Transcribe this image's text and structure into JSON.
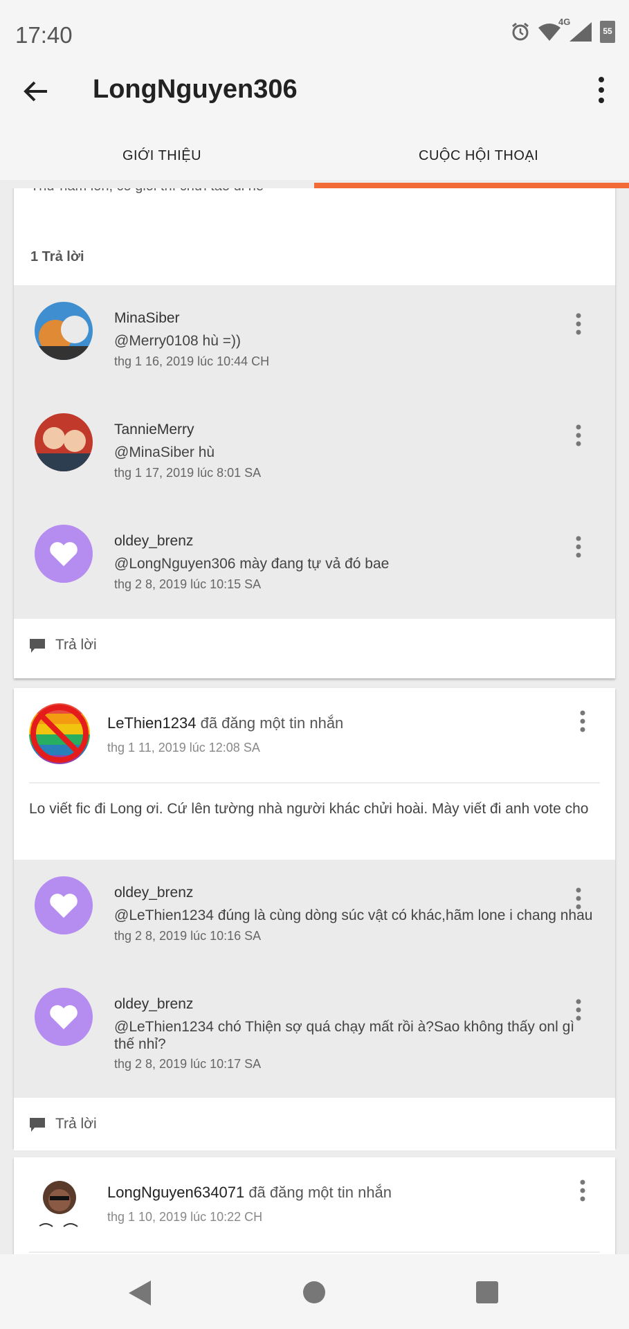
{
  "status_bar": {
    "time": "17:40",
    "network": "4G",
    "battery": "55"
  },
  "app_bar": {
    "title": "LongNguyen306",
    "back_icon": "arrow-left-icon",
    "menu_icon": "more-vert-icon",
    "tabs": [
      {
        "label": "GIỚI THIỆU",
        "selected": false
      },
      {
        "label": "CUỘC HỘI THOẠI",
        "selected": true
      }
    ],
    "accent_color": "#f26a35"
  },
  "feed": {
    "first_card": {
      "partial_text": "Thứ năm lồn, có giỏi thì chửi tao đi nè",
      "reply_count": "1 Trả lời",
      "replies": [
        {
          "name": "MinaSiber",
          "text": "@Merry0108 hù =))",
          "time": "thg 1 16, 2019 lúc 10:44 CH"
        },
        {
          "name": "TannieMerry",
          "text": "@MinaSiber hù",
          "time": "thg 1 17, 2019 lúc 8:01 SA"
        },
        {
          "name": "oldey_brenz",
          "text": "@LongNguyen306 mày đang tự vả đó bae",
          "time": "thg 2 8, 2019 lúc 10:15 SA"
        }
      ],
      "reply_action": "Trả lời"
    },
    "second_card": {
      "author": "LeThien1234",
      "action": "đã đăng một tin nhắn",
      "time": "thg 1 11, 2019 lúc 12:08 SA",
      "body": "Lo viết fic đi Long ơi. Cứ lên tường nhà người khác chửi hoài. Mày viết đi anh vote cho",
      "replies": [
        {
          "name": "oldey_brenz",
          "text": "@LeThien1234 đúng là cùng dòng súc vật có khác,hãm lone i chang nhau",
          "time": "thg 2 8, 2019 lúc 10:16 SA"
        },
        {
          "name": "oldey_brenz",
          "text": "@LeThien1234 chó Thiện sợ quá chạy mất rồi à?Sao không thấy onl gì thế nhỉ?",
          "time": "thg 2 8, 2019 lúc 10:17 SA"
        }
      ],
      "reply_action": "Trả lời"
    },
    "third_card": {
      "author": "LongNguyen634071",
      "action": "đã đăng một tin nhắn",
      "time": "thg 1 10, 2019 lúc 10:22 CH"
    }
  },
  "nav_bar": {
    "back": "nav-back-icon",
    "home": "nav-home-icon",
    "recents": "nav-recents-icon"
  }
}
